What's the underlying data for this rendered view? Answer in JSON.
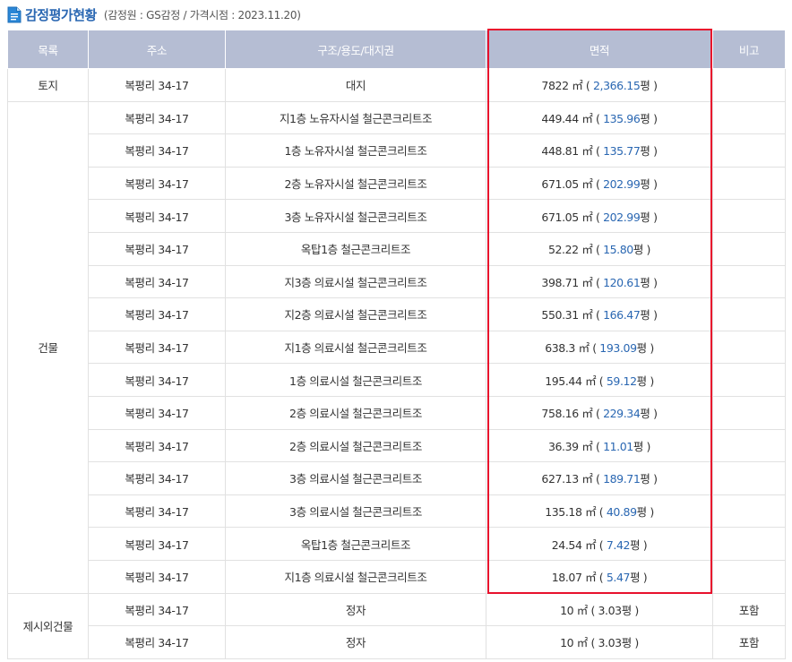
{
  "header": {
    "title": "감정평가현황",
    "subtitle": "(감정원 : GS감정 / 가격시점 : 2023.11.20)"
  },
  "table": {
    "columns": [
      "목록",
      "주소",
      "구조/용도/대지권",
      "면적",
      "비고"
    ],
    "area_unit": "㎡",
    "pyeong_unit": "평",
    "groups": [
      {
        "category": "토지",
        "rows": [
          {
            "address": "복평리 34-17",
            "structure": "대지",
            "area": "7822",
            "pyeong": "2,366.15",
            "note": ""
          }
        ]
      },
      {
        "category": "건물",
        "rows": [
          {
            "address": "복평리 34-17",
            "structure": "지1층 노유자시설 철근콘크리트조",
            "area": "449.44",
            "pyeong": "135.96",
            "note": ""
          },
          {
            "address": "복평리 34-17",
            "structure": "1층 노유자시설 철근콘크리트조",
            "area": "448.81",
            "pyeong": "135.77",
            "note": ""
          },
          {
            "address": "복평리 34-17",
            "structure": "2층 노유자시설 철근콘크리트조",
            "area": "671.05",
            "pyeong": "202.99",
            "note": ""
          },
          {
            "address": "복평리 34-17",
            "structure": "3층 노유자시설 철근콘크리트조",
            "area": "671.05",
            "pyeong": "202.99",
            "note": ""
          },
          {
            "address": "복평리 34-17",
            "structure": "옥탑1층 철근콘크리트조",
            "area": "52.22",
            "pyeong": "15.80",
            "note": ""
          },
          {
            "address": "복평리 34-17",
            "structure": "지3층 의료시설 철근콘크리트조",
            "area": "398.71",
            "pyeong": "120.61",
            "note": ""
          },
          {
            "address": "복평리 34-17",
            "structure": "지2층 의료시설 철근콘크리트조",
            "area": "550.31",
            "pyeong": "166.47",
            "note": ""
          },
          {
            "address": "복평리 34-17",
            "structure": "지1층 의료시설 철근콘크리트조",
            "area": "638.3",
            "pyeong": "193.09",
            "note": ""
          },
          {
            "address": "복평리 34-17",
            "structure": "1층 의료시설 철근콘크리트조",
            "area": "195.44",
            "pyeong": "59.12",
            "note": ""
          },
          {
            "address": "복평리 34-17",
            "structure": "2층 의료시설 철근콘크리트조",
            "area": "758.16",
            "pyeong": "229.34",
            "note": ""
          },
          {
            "address": "복평리 34-17",
            "structure": "2층 의료시설 철근콘크리트조",
            "area": "36.39",
            "pyeong": "11.01",
            "note": ""
          },
          {
            "address": "복평리 34-17",
            "structure": "3층 의료시설 철근콘크리트조",
            "area": "627.13",
            "pyeong": "189.71",
            "note": ""
          },
          {
            "address": "복평리 34-17",
            "structure": "3층 의료시설 철근콘크리트조",
            "area": "135.18",
            "pyeong": "40.89",
            "note": ""
          },
          {
            "address": "복평리 34-17",
            "structure": "옥탑1층 철근콘크리트조",
            "area": "24.54",
            "pyeong": "7.42",
            "note": ""
          },
          {
            "address": "복평리 34-17",
            "structure": "지1층 의료시설 철근콘크리트조",
            "area": "18.07",
            "pyeong": "5.47",
            "note": ""
          }
        ]
      },
      {
        "category": "제시외건물",
        "rows": [
          {
            "address": "복평리 34-17",
            "structure": "정자",
            "area": "10",
            "pyeong": "3.03",
            "note": "포함"
          },
          {
            "address": "복평리 34-17",
            "structure": "정자",
            "area": "10",
            "pyeong": "3.03",
            "note": "포함"
          }
        ]
      }
    ]
  },
  "colors": {
    "title": "#2a67b2",
    "header_bg": "#b5bdd3",
    "pyeong_link": "#2a67b2",
    "highlight": "#e8112d",
    "border": "#e1e1e1"
  }
}
